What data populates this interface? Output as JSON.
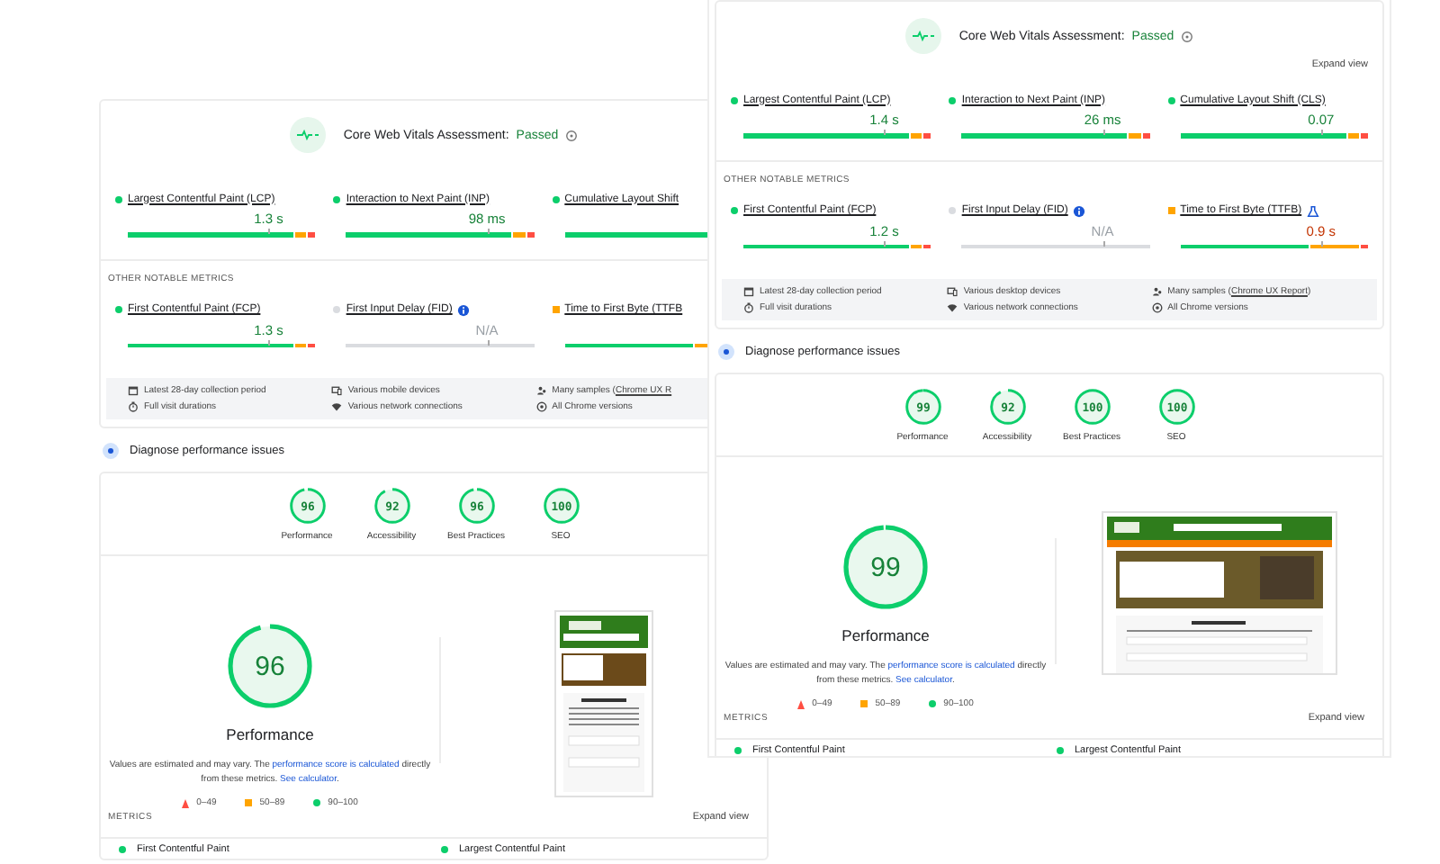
{
  "panels": [
    {
      "assessment": {
        "title": "Core Web Vitals Assessment:",
        "result": "Passed",
        "passed": true
      },
      "vitals": [
        {
          "label": "Largest Contentful Paint (LCP)",
          "kind": "good",
          "color": "#0cce6b",
          "value": "1.3 s"
        },
        {
          "label": "Interaction to Next Paint (INP)",
          "kind": "good",
          "color": "#0cce6b",
          "value": "98 ms"
        },
        {
          "label": "Cumulative Layout Shift",
          "kind": "good",
          "color": "#0cce6b"
        }
      ],
      "other_heading": "OTHER NOTABLE METRICS",
      "other": [
        {
          "label": "First Contentful Paint (FCP)",
          "kind": "good",
          "color": "#0cce6b",
          "value": "1.3 s"
        },
        {
          "label": "First Input Delay (FID)",
          "kind": "na",
          "color": "#dadce0",
          "value": "N/A",
          "info": true
        },
        {
          "label": "Time to First Byte (TTFB",
          "kind": "average",
          "color": "#ffa400"
        }
      ],
      "details": [
        {
          "kind": "calendar",
          "text": "Latest 28-day collection period"
        },
        {
          "kind": "devices",
          "text": "Various mobile devices"
        },
        {
          "kind": "samples",
          "text": "Many samples (",
          "link": "Chrome UX R"
        },
        {
          "kind": "duration",
          "text": "Full visit durations"
        },
        {
          "kind": "network",
          "text": "Various network connections"
        },
        {
          "kind": "versions",
          "text": "All Chrome versions"
        }
      ],
      "diagnose": "Diagnose performance issues",
      "scores": [
        {
          "label": "Performance",
          "score": "96"
        },
        {
          "label": "Accessibility",
          "score": "92"
        },
        {
          "label": "Best Practices",
          "score": "96"
        },
        {
          "label": "SEO",
          "score": "100"
        }
      ],
      "main_score": {
        "score": "96",
        "title": "Performance"
      },
      "description": [
        {
          "text": "Values are estimated and may vary. The "
        },
        {
          "text": "performance score is calculated",
          "link": true
        },
        {
          "text": " directly from these metrics. "
        },
        {
          "text": "See calculator",
          "link": true
        },
        {
          "text": "."
        }
      ],
      "legend": [
        {
          "kind": "fail",
          "range": "0–49"
        },
        {
          "kind": "average",
          "range": "50–89"
        },
        {
          "kind": "pass",
          "range": "90–100"
        }
      ],
      "screenshot": {
        "kind": "mobile"
      },
      "metrics_heading": "METRICS",
      "metrics_expand": "Expand view",
      "metrics": [
        {
          "label": "First Contentful Paint",
          "kind": "good",
          "color": "#0cce6b"
        },
        {
          "label": "Largest Contentful Paint",
          "kind": "good",
          "color": "#0cce6b"
        }
      ]
    },
    {
      "assessment": {
        "title": "Core Web Vitals Assessment:",
        "result": "Passed",
        "passed": true
      },
      "expand": "Expand view",
      "vitals": [
        {
          "label": "Largest Contentful Paint (LCP)",
          "kind": "good",
          "color": "#0cce6b",
          "value": "1.4 s"
        },
        {
          "label": "Interaction to Next Paint (INP)",
          "kind": "good",
          "color": "#0cce6b",
          "value": "26 ms"
        },
        {
          "label": "Cumulative Layout Shift (CLS)",
          "kind": "good",
          "color": "#0cce6b",
          "value": "0.07"
        }
      ],
      "other_heading": "OTHER NOTABLE METRICS",
      "other": [
        {
          "label": "First Contentful Paint (FCP)",
          "kind": "good",
          "color": "#0cce6b",
          "value": "1.2 s"
        },
        {
          "label": "First Input Delay (FID)",
          "kind": "na",
          "color": "#dadce0",
          "value": "N/A",
          "info": true
        },
        {
          "label": "Time to First Byte (TTFB)",
          "kind": "average",
          "color": "#ffa400",
          "value": "0.9 s",
          "experimental": true
        }
      ],
      "details": [
        {
          "kind": "calendar",
          "text": "Latest 28-day collection period"
        },
        {
          "kind": "devices",
          "text": "Various desktop devices"
        },
        {
          "kind": "samples",
          "text": "Many samples (",
          "link": "Chrome UX Report",
          "suffix": ")"
        },
        {
          "kind": "duration",
          "text": "Full visit durations"
        },
        {
          "kind": "network",
          "text": "Various network connections"
        },
        {
          "kind": "versions",
          "text": "All Chrome versions"
        }
      ],
      "diagnose": "Diagnose performance issues",
      "scores": [
        {
          "label": "Performance",
          "score": "99"
        },
        {
          "label": "Accessibility",
          "score": "92"
        },
        {
          "label": "Best Practices",
          "score": "100"
        },
        {
          "label": "SEO",
          "score": "100"
        }
      ],
      "main_score": {
        "score": "99",
        "title": "Performance"
      },
      "description": [
        {
          "text": "Values are estimated and may vary. The "
        },
        {
          "text": "performance score is calculated",
          "link": true
        },
        {
          "text": " directly from these metrics. "
        },
        {
          "text": "See calculator",
          "link": true
        },
        {
          "text": "."
        }
      ],
      "legend": [
        {
          "kind": "fail",
          "range": "0–49"
        },
        {
          "kind": "average",
          "range": "50–89"
        },
        {
          "kind": "pass",
          "range": "90–100"
        }
      ],
      "screenshot": {
        "kind": "desktop"
      },
      "metrics_heading": "METRICS",
      "metrics_expand": "Expand view",
      "metrics": [
        {
          "label": "First Contentful Paint",
          "kind": "good",
          "color": "#0cce6b"
        },
        {
          "label": "Largest Contentful Paint",
          "kind": "good",
          "color": "#0cce6b"
        }
      ]
    }
  ]
}
